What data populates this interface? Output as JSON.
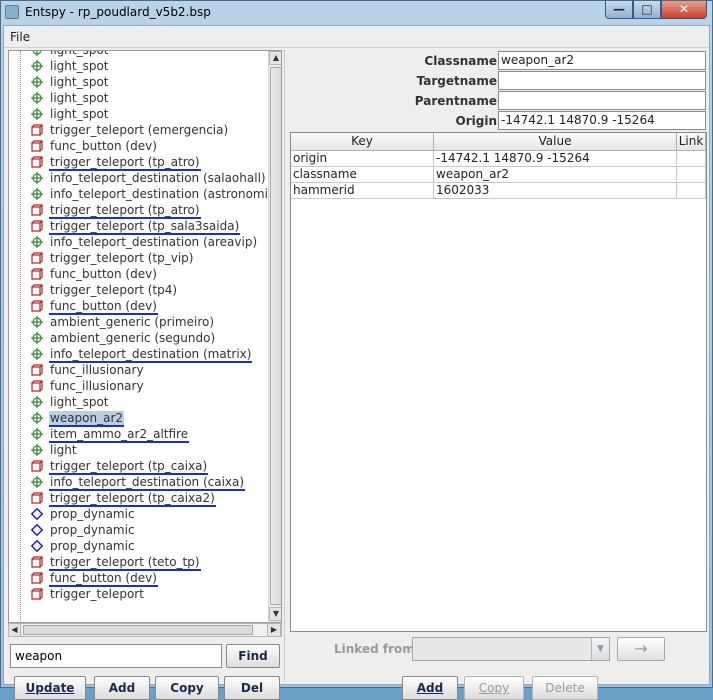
{
  "window": {
    "title": "Entspy - rp_poudlard_v5b2.bsp",
    "controls": {
      "minimize": "—",
      "maximize": "□",
      "close": "✕"
    }
  },
  "menu": {
    "file": "File"
  },
  "tree": {
    "items": [
      {
        "label": "light_spot",
        "type": "point",
        "underlined": false,
        "selected": false
      },
      {
        "label": "light_spot",
        "type": "point",
        "underlined": false,
        "selected": false
      },
      {
        "label": "light_spot",
        "type": "point",
        "underlined": false,
        "selected": false
      },
      {
        "label": "light_spot",
        "type": "point",
        "underlined": false,
        "selected": false
      },
      {
        "label": "light_spot",
        "type": "point",
        "underlined": false,
        "selected": false
      },
      {
        "label": "trigger_teleport (emergencia)",
        "type": "brush",
        "underlined": false,
        "selected": false
      },
      {
        "label": "func_button (dev)",
        "type": "brush",
        "underlined": false,
        "selected": false
      },
      {
        "label": "trigger_teleport (tp_atro)",
        "type": "brush",
        "underlined": true,
        "selected": false
      },
      {
        "label": "info_teleport_destination (salaohall)",
        "type": "point",
        "underlined": false,
        "selected": false
      },
      {
        "label": "info_teleport_destination (astronomia)",
        "type": "point",
        "underlined": false,
        "selected": false
      },
      {
        "label": "trigger_teleport (tp_atro)",
        "type": "brush",
        "underlined": true,
        "selected": false
      },
      {
        "label": "trigger_teleport (tp_sala3saida)",
        "type": "brush",
        "underlined": true,
        "selected": false
      },
      {
        "label": "info_teleport_destination (areavip)",
        "type": "point",
        "underlined": false,
        "selected": false
      },
      {
        "label": "trigger_teleport (tp_vip)",
        "type": "brush",
        "underlined": false,
        "selected": false
      },
      {
        "label": "func_button (dev)",
        "type": "brush",
        "underlined": false,
        "selected": false
      },
      {
        "label": "trigger_teleport (tp4)",
        "type": "brush",
        "underlined": false,
        "selected": false
      },
      {
        "label": "func_button (dev)",
        "type": "brush",
        "underlined": true,
        "selected": false
      },
      {
        "label": "ambient_generic (primeiro)",
        "type": "point",
        "underlined": false,
        "selected": false
      },
      {
        "label": "ambient_generic (segundo)",
        "type": "point",
        "underlined": false,
        "selected": false
      },
      {
        "label": "info_teleport_destination (matrix)",
        "type": "point",
        "underlined": true,
        "selected": false
      },
      {
        "label": "func_illusionary",
        "type": "brush",
        "underlined": false,
        "selected": false
      },
      {
        "label": "func_illusionary",
        "type": "brush",
        "underlined": false,
        "selected": false
      },
      {
        "label": "light_spot",
        "type": "point",
        "underlined": false,
        "selected": false
      },
      {
        "label": "weapon_ar2",
        "type": "point",
        "underlined": true,
        "selected": true
      },
      {
        "label": "item_ammo_ar2_altfire",
        "type": "point",
        "underlined": true,
        "selected": false
      },
      {
        "label": "light",
        "type": "point",
        "underlined": false,
        "selected": false
      },
      {
        "label": "trigger_teleport (tp_caixa)",
        "type": "brush",
        "underlined": true,
        "selected": false
      },
      {
        "label": "info_teleport_destination (caixa)",
        "type": "point",
        "underlined": true,
        "selected": false
      },
      {
        "label": "trigger_teleport (tp_caixa2)",
        "type": "brush",
        "underlined": true,
        "selected": false
      },
      {
        "label": "prop_dynamic",
        "type": "model",
        "underlined": false,
        "selected": false
      },
      {
        "label": "prop_dynamic",
        "type": "model",
        "underlined": false,
        "selected": false
      },
      {
        "label": "prop_dynamic",
        "type": "model",
        "underlined": false,
        "selected": false
      },
      {
        "label": "trigger_teleport (teto_tp)",
        "type": "brush",
        "underlined": true,
        "selected": false
      },
      {
        "label": "func_button (dev)",
        "type": "brush",
        "underlined": true,
        "selected": false
      },
      {
        "label": "trigger_teleport",
        "type": "brush",
        "underlined": false,
        "selected": false
      }
    ],
    "icons": {
      "point": "crosshair-icon",
      "brush": "cube-icon",
      "model": "diamond-icon"
    },
    "colors": {
      "point": "#2f8a2f",
      "brush": "#b22222",
      "model": "#1a1aa0",
      "underline": "#1a2fd0",
      "selection": "#b8cfe5"
    }
  },
  "search": {
    "value": "weapon",
    "find_label": "Find"
  },
  "left_buttons": {
    "update": "Update",
    "add": "Add",
    "copy": "Copy",
    "del": "Del"
  },
  "properties": {
    "classname_label": "Classname",
    "classname_value": "weapon_ar2",
    "targetname_label": "Targetname",
    "targetname_value": "",
    "parentname_label": "Parentname",
    "parentname_value": "",
    "origin_label": "Origin",
    "origin_value": "-14742.1 14870.9 -15264"
  },
  "keyvalues": {
    "headers": {
      "key": "Key",
      "value": "Value",
      "link": "Link"
    },
    "rows": [
      {
        "key": "origin",
        "value": "-14742.1 14870.9 -15264"
      },
      {
        "key": "classname",
        "value": "weapon_ar2"
      },
      {
        "key": "hammerid",
        "value": "1602033"
      }
    ]
  },
  "linked": {
    "label": "Linked from",
    "select_value": ""
  },
  "right_buttons": {
    "add": "Add",
    "copy": "Copy",
    "delete": "Delete"
  }
}
